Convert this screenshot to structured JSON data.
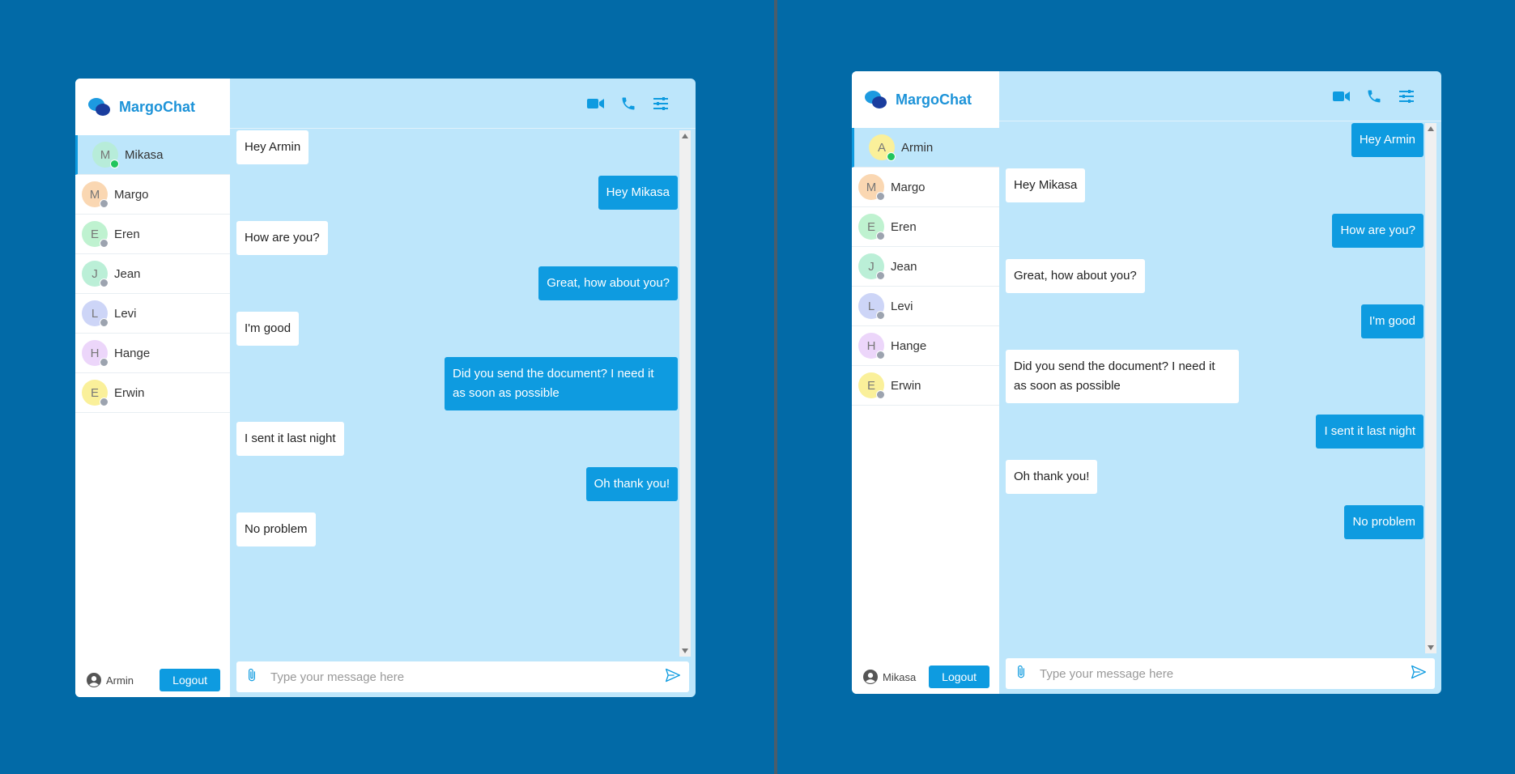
{
  "brand": {
    "name": "MargoChat"
  },
  "colors": {
    "accent": "#0e9be0",
    "online": "#22c55e",
    "offline": "#9ca3af"
  },
  "left_window": {
    "current_user": "Armin",
    "contacts": [
      {
        "initial": "M",
        "name": "Mikasa",
        "avatar_bg": "#b7ecd9",
        "status": "online",
        "active": true
      },
      {
        "initial": "M",
        "name": "Margo",
        "avatar_bg": "#fad7b2",
        "status": "offline",
        "active": false
      },
      {
        "initial": "E",
        "name": "Eren",
        "avatar_bg": "#bff2d0",
        "status": "offline",
        "active": false
      },
      {
        "initial": "J",
        "name": "Jean",
        "avatar_bg": "#bbefd7",
        "status": "offline",
        "active": false
      },
      {
        "initial": "L",
        "name": "Levi",
        "avatar_bg": "#cdd5f7",
        "status": "offline",
        "active": false
      },
      {
        "initial": "H",
        "name": "Hange",
        "avatar_bg": "#ecd6fa",
        "status": "offline",
        "active": false
      },
      {
        "initial": "E",
        "name": "Erwin",
        "avatar_bg": "#faf09a",
        "status": "offline",
        "active": false
      }
    ],
    "messages": [
      {
        "dir": "in",
        "text": "Hey Armin"
      },
      {
        "dir": "out",
        "text": "Hey Mikasa"
      },
      {
        "dir": "in",
        "text": "How are you?"
      },
      {
        "dir": "out",
        "text": "Great, how about you?"
      },
      {
        "dir": "in",
        "text": "I'm good"
      },
      {
        "dir": "out",
        "text": "Did you send the document? I need it as soon as possible"
      },
      {
        "dir": "in",
        "text": "I sent it last night"
      },
      {
        "dir": "out",
        "text": "Oh thank you!"
      },
      {
        "dir": "in",
        "text": "No problem"
      }
    ]
  },
  "right_window": {
    "current_user": "Mikasa",
    "contacts": [
      {
        "initial": "A",
        "name": "Armin",
        "avatar_bg": "#faf09a",
        "status": "online",
        "active": true
      },
      {
        "initial": "M",
        "name": "Margo",
        "avatar_bg": "#fad7b2",
        "status": "offline",
        "active": false
      },
      {
        "initial": "E",
        "name": "Eren",
        "avatar_bg": "#bff2d0",
        "status": "offline",
        "active": false
      },
      {
        "initial": "J",
        "name": "Jean",
        "avatar_bg": "#bbefd7",
        "status": "offline",
        "active": false
      },
      {
        "initial": "L",
        "name": "Levi",
        "avatar_bg": "#cdd5f7",
        "status": "offline",
        "active": false
      },
      {
        "initial": "H",
        "name": "Hange",
        "avatar_bg": "#ecd6fa",
        "status": "offline",
        "active": false
      },
      {
        "initial": "E",
        "name": "Erwin",
        "avatar_bg": "#faf09a",
        "status": "offline",
        "active": false
      }
    ],
    "messages": [
      {
        "dir": "out",
        "text": "Hey Armin"
      },
      {
        "dir": "in",
        "text": "Hey Mikasa"
      },
      {
        "dir": "out",
        "text": "How are you?"
      },
      {
        "dir": "in",
        "text": "Great, how about you?"
      },
      {
        "dir": "out",
        "text": "I'm good"
      },
      {
        "dir": "in",
        "text": "Did you send the document? I need it as soon as possible"
      },
      {
        "dir": "out",
        "text": "I sent it last night"
      },
      {
        "dir": "in",
        "text": "Oh thank you!"
      },
      {
        "dir": "out",
        "text": "No problem"
      }
    ]
  },
  "ui": {
    "logout_label": "Logout",
    "composer_placeholder": "Type your message here",
    "topbar_icons": [
      "video-icon",
      "phone-icon",
      "settings-sliders-icon"
    ]
  }
}
